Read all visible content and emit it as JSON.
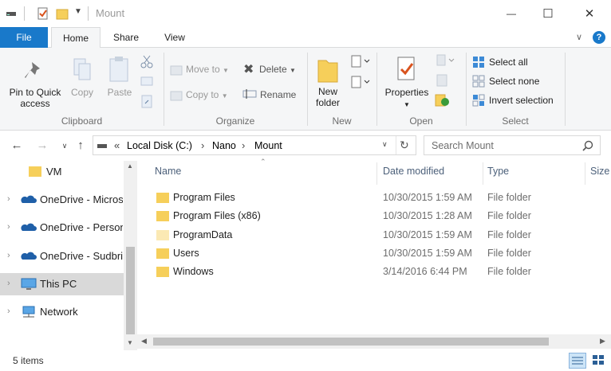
{
  "window": {
    "title": "Mount",
    "minimize": "—",
    "maximize": "☐",
    "close": "✕"
  },
  "tabs": {
    "file": "File",
    "home": "Home",
    "share": "Share",
    "view": "View"
  },
  "ribbon": {
    "clipboard": {
      "pin": "Pin to Quick\naccess",
      "copy": "Copy",
      "paste": "Paste",
      "label": "Clipboard"
    },
    "organize": {
      "move_to": "Move to",
      "copy_to": "Copy to",
      "delete": "Delete",
      "rename": "Rename",
      "label": "Organize"
    },
    "new": {
      "new_folder": "New\nfolder",
      "label": "New"
    },
    "open": {
      "properties": "Properties",
      "label": "Open"
    },
    "select": {
      "select_all": "Select all",
      "select_none": "Select none",
      "invert": "Invert selection",
      "label": "Select"
    }
  },
  "address": {
    "prefix": "«",
    "crumbs": [
      "Local Disk (C:)",
      "Nano",
      "Mount"
    ],
    "sep": "›"
  },
  "search": {
    "placeholder": "Search Mount"
  },
  "nav_pane": {
    "items": [
      {
        "label": "VM",
        "icon": "folder-icon"
      },
      {
        "label": "OneDrive - Micros",
        "icon": "onedrive-icon"
      },
      {
        "label": "OneDrive - Person",
        "icon": "onedrive-icon"
      },
      {
        "label": "OneDrive - Sudbri",
        "icon": "onedrive-icon"
      },
      {
        "label": "This PC",
        "icon": "pc-icon"
      },
      {
        "label": "Network",
        "icon": "network-icon"
      }
    ]
  },
  "columns": {
    "name": "Name",
    "date": "Date modified",
    "type": "Type",
    "size": "Size"
  },
  "files": [
    {
      "name": "Program Files",
      "date": "10/30/2015 1:59 AM",
      "type": "File folder"
    },
    {
      "name": "Program Files (x86)",
      "date": "10/30/2015 1:28 AM",
      "type": "File folder"
    },
    {
      "name": "ProgramData",
      "date": "10/30/2015 1:59 AM",
      "type": "File folder"
    },
    {
      "name": "Users",
      "date": "10/30/2015 1:59 AM",
      "type": "File folder"
    },
    {
      "name": "Windows",
      "date": "3/14/2016 6:44 PM",
      "type": "File folder"
    }
  ],
  "status": {
    "count": "5 items"
  },
  "colors": {
    "accent": "#1979ca",
    "folder": "#f6cf5a",
    "selected": "#d9d9d9"
  }
}
